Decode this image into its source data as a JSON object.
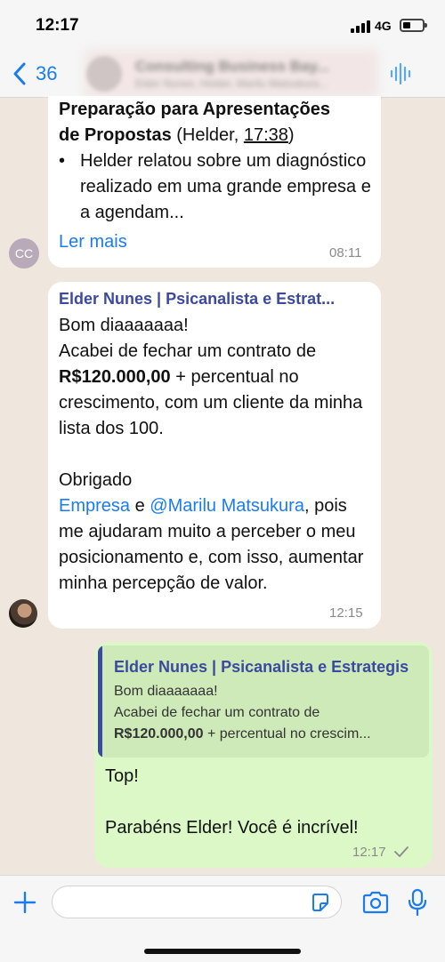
{
  "status_bar": {
    "time": "12:17",
    "network": "4G"
  },
  "header": {
    "back_count": "36",
    "chat_title": "Consulting Business Bay...",
    "chat_subtitle": "Elder Nunes, Helder, Marilu Matsukura..."
  },
  "messages": [
    {
      "sender_avatar_initials": "CC",
      "header_text": "Preparação para Apresentações",
      "header_text_2": "de Propostas",
      "header_tail": " (Helder, ",
      "header_time_link": "17:38",
      "header_close": ")",
      "bullet": "•",
      "bullet_text": "Helder relatou sobre um diagnóstico realizado em uma grande empresa e a agendam...",
      "read_more": "Ler mais",
      "time": "08:11"
    },
    {
      "sender": "Elder Nunes | Psicanalista e Estrat...",
      "line1": "Bom diaaaaaaa!",
      "line2": "Acabei de fechar um contrato de",
      "amount": "R$120.000,00",
      "line3": " + percentual no crescimento, com um cliente da minha lista dos 100.",
      "line4": "Obrigado",
      "mention1": "Empresa",
      "conj": " e ",
      "mention2": "@Marilu Matsukura",
      "line5": ", pois me ajudaram muito a perceber o meu posicionamento e, com isso, aumentar minha percepção de valor.",
      "time": "12:15"
    },
    {
      "quote_sender": "Elder Nunes | Psicanalista e Estrategis",
      "quote_line1": "Bom diaaaaaaa!",
      "quote_line2": "Acabei de fechar um contrato de",
      "quote_amount": "R$120.000,00",
      "quote_line3": " + percentual no crescim...",
      "line1": "Top!",
      "line2": "Parabéns Elder! Você é incrível!",
      "time": "12:17"
    }
  ],
  "colors": {
    "accent": "#1a7cf0",
    "outgoing": "#dcf8c6",
    "sender": "#3b4aa0"
  }
}
